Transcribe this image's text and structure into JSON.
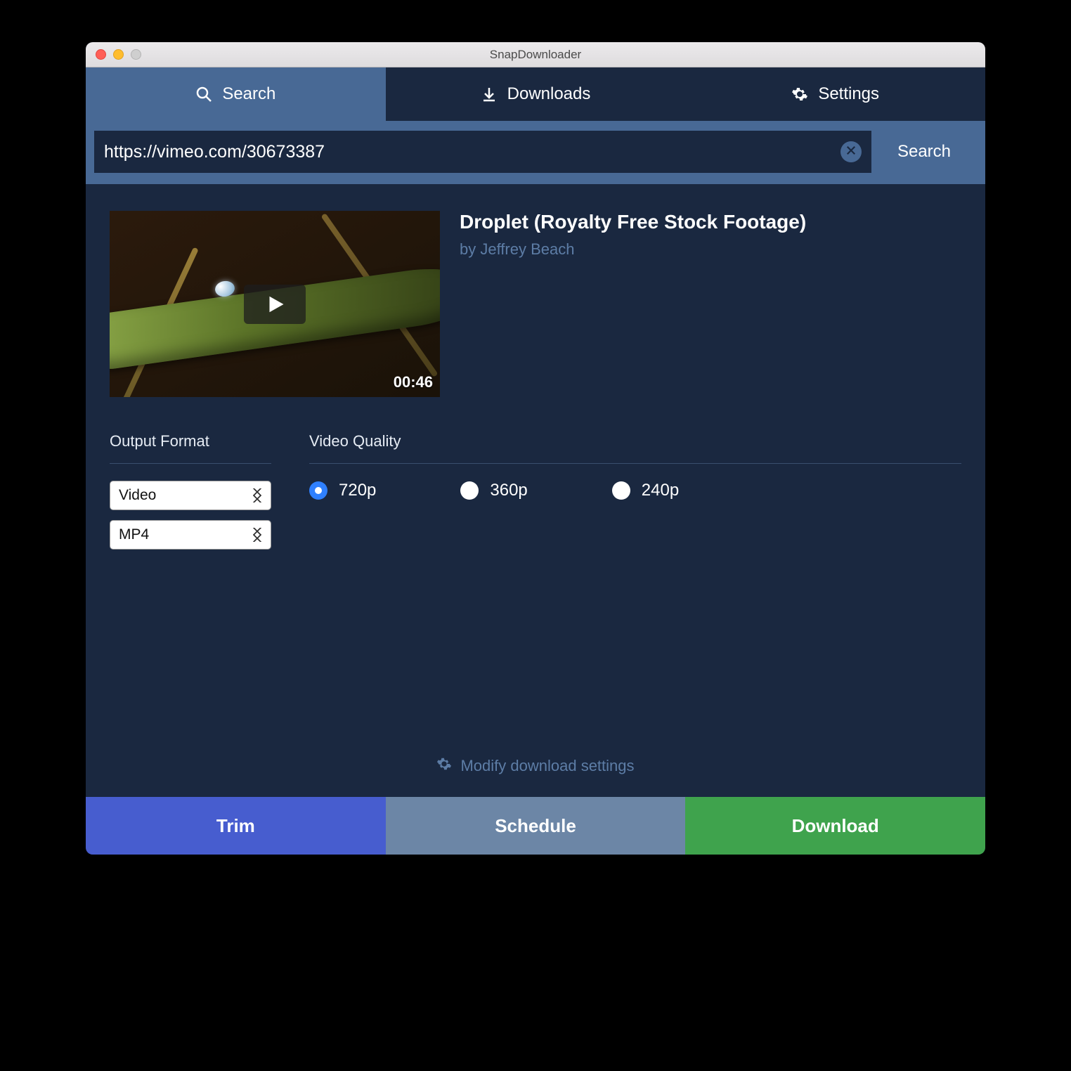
{
  "window": {
    "title": "SnapDownloader"
  },
  "tabs": {
    "search": "Search",
    "downloads": "Downloads",
    "settings": "Settings"
  },
  "search": {
    "url_value": "https://vimeo.com/30673387",
    "search_button": "Search"
  },
  "video": {
    "title": "Droplet (Royalty Free Stock Footage)",
    "author_prefix": "by ",
    "author": "Jeffrey Beach",
    "duration": "00:46"
  },
  "output_format": {
    "heading": "Output Format",
    "type_selected": "Video",
    "container_selected": "MP4"
  },
  "video_quality": {
    "heading": "Video Quality",
    "options": [
      "720p",
      "360p",
      "240p"
    ],
    "selected_index": 0
  },
  "modify_settings_label": "Modify download settings",
  "footer": {
    "trim": "Trim",
    "schedule": "Schedule",
    "download": "Download"
  }
}
